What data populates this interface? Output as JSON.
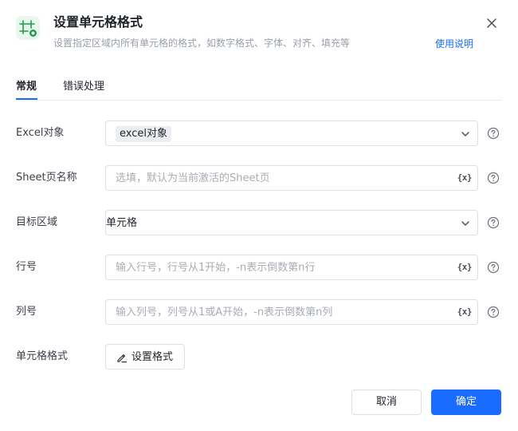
{
  "header": {
    "title": "设置单元格格式",
    "subtitle": "设置指定区域内所有单元格的格式，如数字格式、字体、对齐、填充等",
    "help_link": "使用说明",
    "icon": "table-grid-icon"
  },
  "tabs": [
    {
      "label": "常规",
      "active": true
    },
    {
      "label": "错误处理",
      "active": false
    }
  ],
  "fields": {
    "excel_object": {
      "label": "Excel对象",
      "value": "excel对象"
    },
    "sheet_name": {
      "label": "Sheet页名称",
      "placeholder": "选填，默认为当前激活的Sheet页"
    },
    "target_area": {
      "label": "目标区域",
      "value": "单元格"
    },
    "row_number": {
      "label": "行号",
      "placeholder": "输入行号，行号从1开始，-n表示倒数第n行"
    },
    "col_number": {
      "label": "列号",
      "placeholder": "输入列号，列号从1或A开始，-n表示倒数第n列"
    },
    "cell_format": {
      "label": "单元格格式",
      "button": "设置格式"
    }
  },
  "variable_icon_text": "{x}",
  "footer": {
    "cancel": "取消",
    "ok": "确定"
  },
  "colors": {
    "accent": "#1a6bff",
    "icon_green": "#1aa34a"
  }
}
